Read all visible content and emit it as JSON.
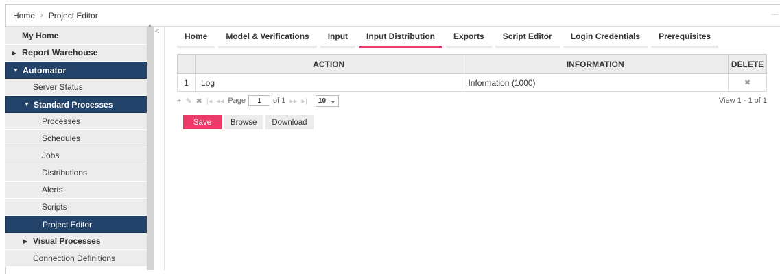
{
  "breadcrumb": {
    "home": "Home",
    "separator": "›",
    "current": "Project Editor"
  },
  "sidebar": {
    "items": [
      {
        "label": "My Home"
      },
      {
        "label": "Report Warehouse",
        "caret": "▶"
      },
      {
        "label": "Automator",
        "caret": "▼"
      },
      {
        "label": "Server Status"
      },
      {
        "label": "Standard Processes",
        "caret": "▼"
      },
      {
        "label": "Processes"
      },
      {
        "label": "Schedules"
      },
      {
        "label": "Jobs"
      },
      {
        "label": "Distributions"
      },
      {
        "label": "Alerts"
      },
      {
        "label": "Scripts"
      },
      {
        "label": "Project Editor"
      },
      {
        "label": "Visual Processes",
        "caret": "▶"
      },
      {
        "label": "Connection Definitions"
      }
    ],
    "collapse_icon": "<"
  },
  "tabs": [
    {
      "label": "Home"
    },
    {
      "label": "Model & Verifications"
    },
    {
      "label": "Input"
    },
    {
      "label": "Input Distribution"
    },
    {
      "label": "Exports"
    },
    {
      "label": "Script Editor"
    },
    {
      "label": "Login Credentials"
    },
    {
      "label": "Prerequisites"
    }
  ],
  "active_tab": "Input Distribution",
  "grid": {
    "columns": [
      "",
      "ACTION",
      "INFORMATION",
      "DELETE"
    ],
    "rows": [
      {
        "num": "1",
        "action": "Log",
        "information": "Information (1000)",
        "delete": "✖"
      }
    ]
  },
  "pager": {
    "add_icon": "+",
    "edit_icon": "✎",
    "delete_icon": "✖",
    "first_icon": "|◂",
    "prev_icon": "◂◂",
    "page_label": "Page",
    "page_value": "1",
    "of_label": "of 1",
    "next_icon": "▸▸",
    "last_icon": "▸|",
    "page_size": "10",
    "view_text": "View 1 - 1 of 1"
  },
  "buttons": {
    "save": "Save",
    "browse": "Browse",
    "download": "Download"
  },
  "colors": {
    "active_nav": "#24436a",
    "accent": "#ea3a68"
  }
}
